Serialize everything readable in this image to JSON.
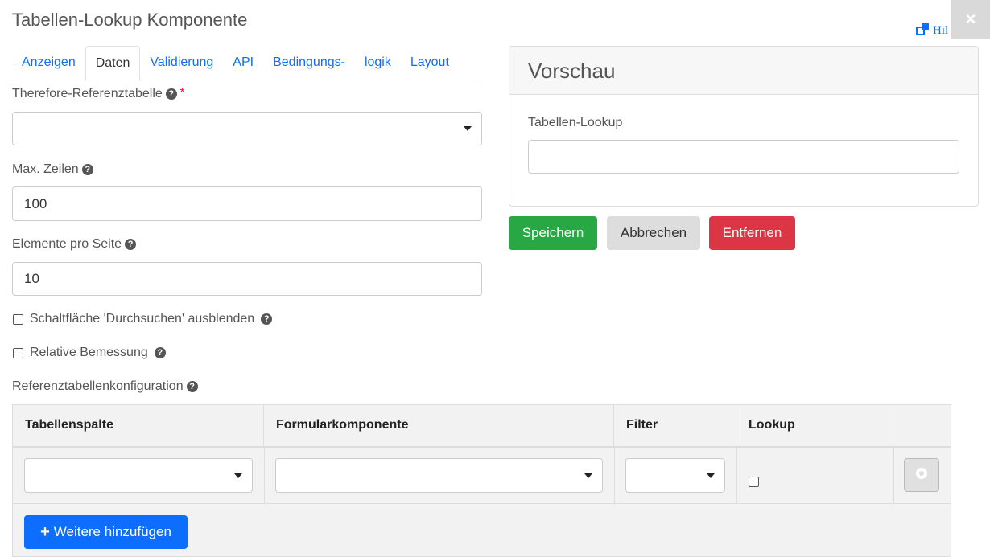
{
  "dialog": {
    "title": "Tabellen-Lookup Komponente",
    "help_label": "Hil",
    "close_label": "×"
  },
  "tabs": [
    {
      "label": "Anzeigen",
      "active": false
    },
    {
      "label": "Daten",
      "active": true
    },
    {
      "label": "Validierung",
      "active": false
    },
    {
      "label": "API",
      "active": false
    },
    {
      "label": "Bedingungs-",
      "active": false
    },
    {
      "label": "logik",
      "active": false
    },
    {
      "label": "Layout",
      "active": false
    }
  ],
  "form": {
    "ref_table_label": "Therefore-Referenztabelle",
    "ref_table_required": "*",
    "ref_table_value": "",
    "max_rows_label": "Max. Zeilen",
    "max_rows_value": "100",
    "per_page_label": "Elemente pro Seite",
    "per_page_value": "10",
    "hide_browse_label": "Schaltfläche 'Durchsuchen' ausblenden",
    "relative_size_label": "Relative Bemessung",
    "ref_config_label": "Referenztabellenkonfiguration",
    "help_icon": "?"
  },
  "preview": {
    "title": "Vorschau",
    "field_label": "Tabellen-Lookup",
    "field_value": ""
  },
  "actions": {
    "save": "Speichern",
    "cancel": "Abbrechen",
    "remove": "Entfernen"
  },
  "colors": {
    "save": "#28a745",
    "cancel": "#dddddd",
    "remove": "#dc3545",
    "primary": "#0d6efd"
  },
  "table": {
    "headers": [
      "Tabellenspalte",
      "Formularkomponente",
      "Filter",
      "Lookup",
      ""
    ],
    "add_label": "Weitere hinzufügen",
    "add_icon": "+"
  }
}
